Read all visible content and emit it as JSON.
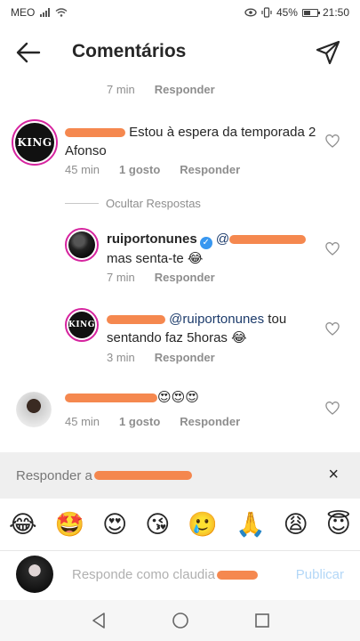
{
  "status_bar": {
    "carrier": "MEO",
    "battery_percent": "45%",
    "battery_level": 0.45,
    "time": "21:50"
  },
  "header": {
    "title": "Comentários"
  },
  "comments": [
    {
      "time": "7 min",
      "reply_label": "Responder"
    },
    {
      "text": " Estou à espera da temporada 2 Afonso",
      "avatar_text": "KING",
      "time": "45 min",
      "likes": "1 gosto",
      "reply_label": "Responder",
      "hide_replies": "Ocultar Respostas",
      "replies": [
        {
          "username": "ruiportonunes",
          "mention_prefix": "@",
          "text": "mas senta-te 😂",
          "time": "7 min",
          "reply_label": "Responder"
        },
        {
          "avatar_text": "KING",
          "mention": "@ruiportonunes",
          "text": " tou sentando faz 5horas 😂",
          "time": "3 min",
          "reply_label": "Responder"
        }
      ]
    },
    {
      "text": "😍😍😍",
      "time": "45 min",
      "likes": "1 gosto",
      "reply_label": "Responder"
    }
  ],
  "reply_bar": {
    "label": "Responder a ",
    "close": "×"
  },
  "emoji_bar": [
    "😂",
    "🤩",
    "😍",
    "😘",
    "🥲",
    "🙏",
    "😩",
    "😇"
  ],
  "composer": {
    "placeholder": "Responde como claudia",
    "publish": "Publicar"
  },
  "colors": {
    "accent": "#3897f0",
    "ring": "#d6249f",
    "scribble": "#f47b3c"
  }
}
